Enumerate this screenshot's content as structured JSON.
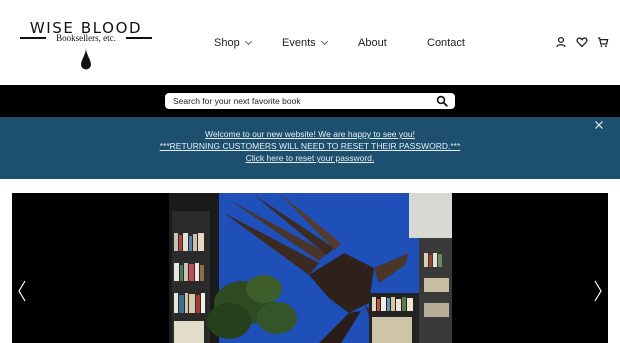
{
  "brand": {
    "title": "WISE BLOOD",
    "subtitle": "Booksellers, etc."
  },
  "nav": {
    "items": [
      {
        "label": "Shop",
        "has_dropdown": true
      },
      {
        "label": "Events",
        "has_dropdown": true
      },
      {
        "label": "About",
        "has_dropdown": false
      },
      {
        "label": "Contact",
        "has_dropdown": false
      }
    ]
  },
  "header_icons": [
    "user-icon",
    "heart-icon",
    "cart-icon"
  ],
  "search": {
    "placeholder": "Search for your next favorite book",
    "icon": "search-icon"
  },
  "announcement": {
    "lines": [
      "Welcome to our new website! We are happy to see you!",
      "***RETURNING CUSTOMERS WILL NEED TO RESET THEIR PASSWORD.***",
      "Click here to reset your password."
    ],
    "close_icon": "close-icon"
  },
  "hero": {
    "prev_icon": "chevron-left-icon",
    "next_icon": "chevron-right-icon"
  },
  "colors": {
    "announcement_bg": "#1d4f6e",
    "search_bar_bg": "#000000",
    "wall_blue": "#1f4fb8"
  }
}
